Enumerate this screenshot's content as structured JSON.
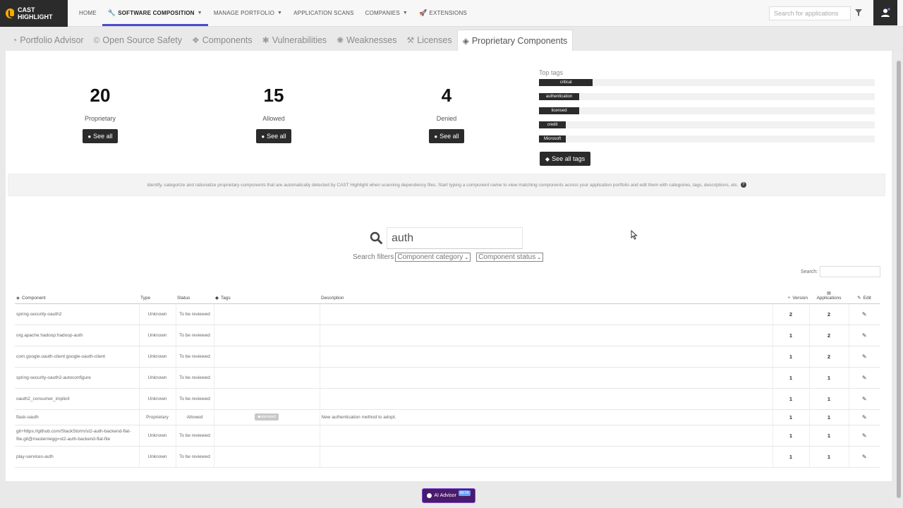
{
  "brand": {
    "name": "CAST HIGHLIGHT",
    "accent": "#4a4ad0",
    "logo_color": "#f2a900"
  },
  "nav": {
    "home": "HOME",
    "software_composition": "SOFTWARE COMPOSITION",
    "manage_portfolio": "MANAGE PORTFOLIO",
    "application_scans": "APPLICATION SCANS",
    "companies": "COMPANIES",
    "extensions": "EXTENSIONS"
  },
  "header": {
    "search_placeholder": "Search for applications"
  },
  "tabs": [
    {
      "label": "Portfolio Advisor",
      "icon": "pie-chart-icon"
    },
    {
      "label": "Open Source Safety",
      "icon": "copyright-icon"
    },
    {
      "label": "Components",
      "icon": "cubes-icon"
    },
    {
      "label": "Vulnerabilities",
      "icon": "bug-icon"
    },
    {
      "label": "Weaknesses",
      "icon": "spider-icon"
    },
    {
      "label": "Licenses",
      "icon": "gavel-icon"
    },
    {
      "label": "Proprietary Components",
      "icon": "cube-icon",
      "active": true
    }
  ],
  "stats": {
    "proprietary": {
      "value": "20",
      "label": "Proprietary",
      "button": "See all"
    },
    "allowed": {
      "value": "15",
      "label": "Allowed",
      "button": "See all"
    },
    "denied": {
      "value": "4",
      "label": "Denied",
      "button": "See all"
    }
  },
  "top_tags": {
    "title": "Top tags",
    "items": [
      {
        "label": "critical",
        "share": 0.16
      },
      {
        "label": "authentication",
        "share": 0.12
      },
      {
        "label": "licensed",
        "share": 0.12
      },
      {
        "label": "credit",
        "share": 0.08
      },
      {
        "label": "Microsoft",
        "share": 0.08
      }
    ],
    "button": "See all tags"
  },
  "info_text": "Identify, categorize and rationalize proprietary components that are automatically detected by CAST Highlight when scanning dependency files. Start typing a component name to view matching components across your application portfolio and edit them with categories, tags, descriptions, etc.",
  "search": {
    "value": "auth"
  },
  "filters": {
    "label": "Search filters",
    "category": "Component category",
    "status": "Component status"
  },
  "table_search": {
    "label": "Search:"
  },
  "table": {
    "headers": {
      "component": "Component",
      "type": "Type",
      "status": "Status",
      "tags": "Tags",
      "description": "Description",
      "version": "Version",
      "applications": "Applications",
      "edit": "Edit"
    },
    "rows": [
      {
        "component": "spring-security-oauth2",
        "type": "Unknown",
        "status": "To be reviewed",
        "tag": "",
        "description": "",
        "version": "2",
        "applications": "2"
      },
      {
        "component": "org.apache.hadoop:hadoop-auth",
        "type": "Unknown",
        "status": "To be reviewed",
        "tag": "",
        "description": "",
        "version": "1",
        "applications": "2"
      },
      {
        "component": "com.google.oauth-client:google-oauth-client",
        "type": "Unknown",
        "status": "To be reviewed",
        "tag": "",
        "description": "",
        "version": "1",
        "applications": "2"
      },
      {
        "component": "spring-security-oauth2-autoconfigure",
        "type": "Unknown",
        "status": "To be reviewed",
        "tag": "",
        "description": "",
        "version": "1",
        "applications": "1"
      },
      {
        "component": "oauth2_consumer_implicit",
        "type": "Unknown",
        "status": "To be reviewed",
        "tag": "",
        "description": "",
        "version": "1",
        "applications": "1"
      },
      {
        "component": "flask-oauth",
        "type": "Proprietary",
        "status": "Allowed",
        "tag": "standard",
        "description": "New authentication method to adopt.",
        "version": "1",
        "applications": "1"
      },
      {
        "component": "git+https://github.com/StackStorm/st2-auth-backend-flat-file.git@master#egg=st2-auth-backend-flat-file",
        "type": "Unknown",
        "status": "To be reviewed",
        "tag": "",
        "description": "",
        "version": "1",
        "applications": "1"
      },
      {
        "component": "play-services-auth",
        "type": "Unknown",
        "status": "To be reviewed",
        "tag": "",
        "description": "",
        "version": "1",
        "applications": "1"
      }
    ]
  },
  "ai_advisor": {
    "label": "AI Advisor",
    "badge": "BETA"
  }
}
